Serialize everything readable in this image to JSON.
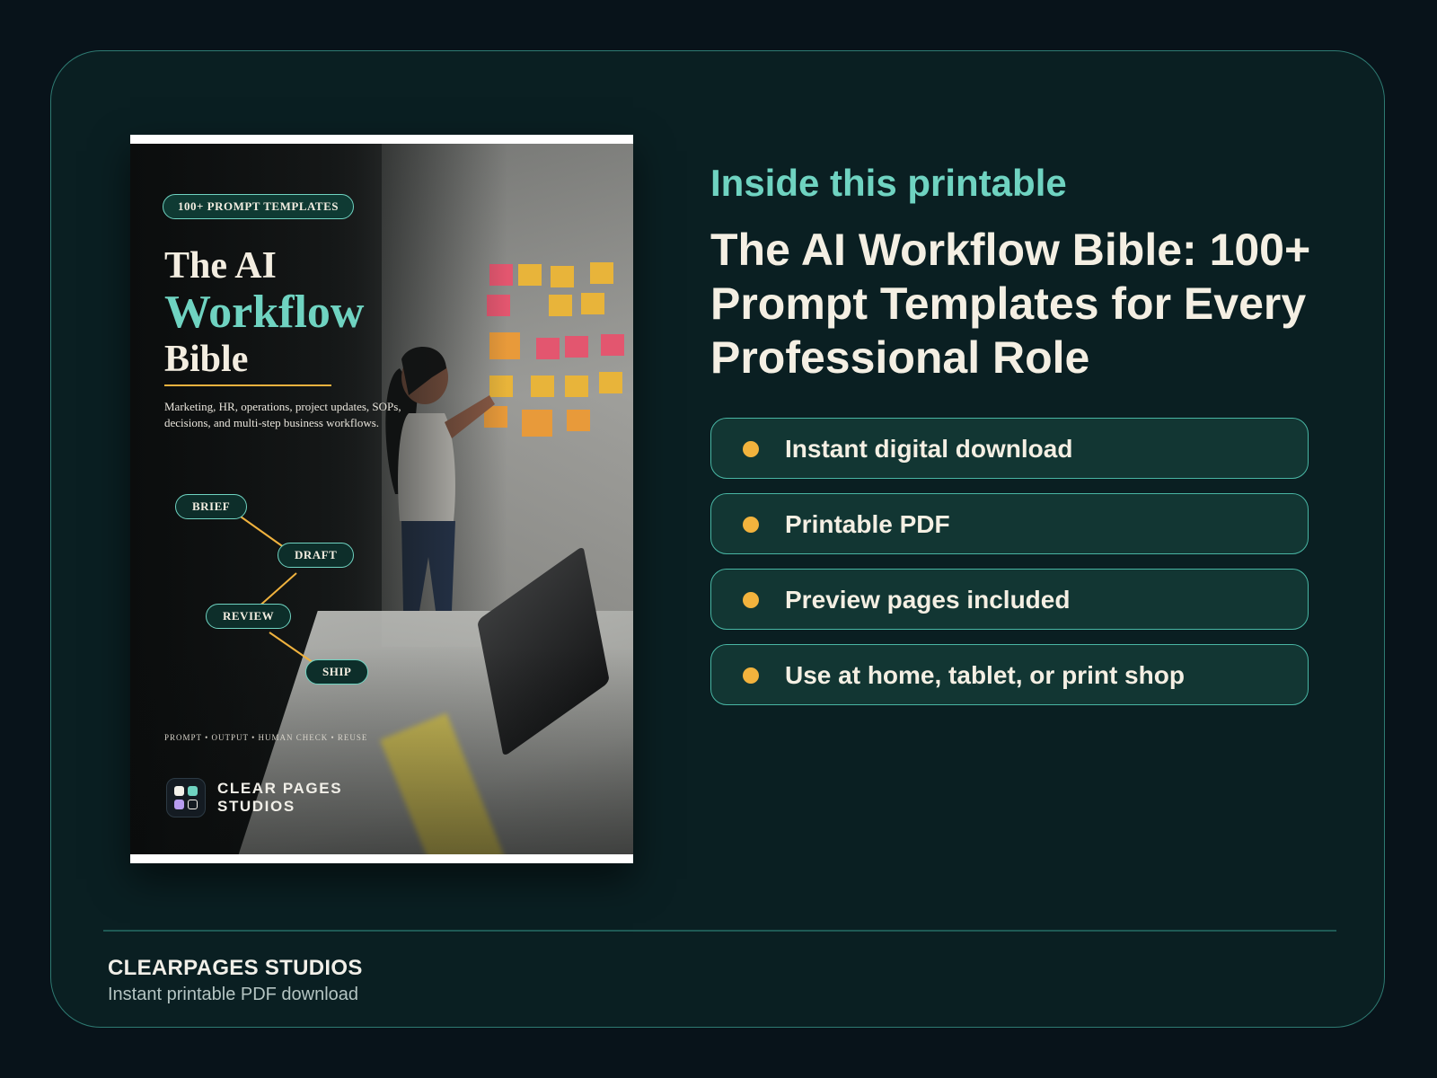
{
  "cover": {
    "badge": "100+ PROMPT TEMPLATES",
    "title_line1": "The AI",
    "title_line2": "Workflow",
    "title_line3": "Bible",
    "subtitle": "Marketing, HR, operations, project updates, SOPs, decisions, and multi-step business workflows.",
    "flow": [
      "BRIEF",
      "DRAFT",
      "REVIEW",
      "SHIP"
    ],
    "footer_steps": "PROMPT • OUTPUT • HUMAN CHECK • REUSE",
    "brand_line1": "CLEAR PAGES",
    "brand_line2": "STUDIOS"
  },
  "info": {
    "eyebrow": "Inside this printable",
    "headline": "The AI Workflow Bible: 100+ Prompt Templates for Every Professional Role",
    "features": [
      "Instant digital download",
      "Printable PDF",
      "Preview pages included",
      "Use at home, tablet, or print shop"
    ]
  },
  "footer": {
    "brand": "CLEARPAGES STUDIOS",
    "tagline": "Instant printable PDF download"
  },
  "colors": {
    "background": "#08131a",
    "card": "#0a1f22",
    "accent_teal": "#6fd3c1",
    "accent_gold": "#f2b33d",
    "text_light": "#f4efe3"
  }
}
